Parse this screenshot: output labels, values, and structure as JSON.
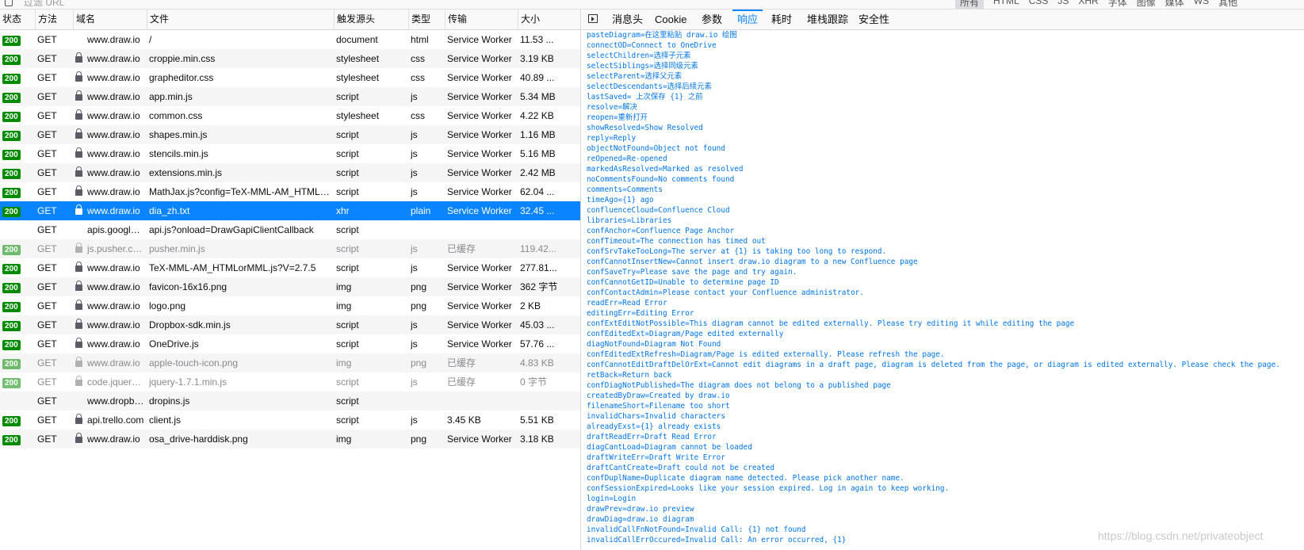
{
  "toolbar": {
    "filter_placeholder": "过滤 URL",
    "type_filters": [
      "所有",
      "HTML",
      "CSS",
      "JS",
      "XHR",
      "字体",
      "图像",
      "媒体",
      "WS",
      "其他"
    ]
  },
  "columns": [
    "状态",
    "方法",
    "域名",
    "文件",
    "触发源头",
    "类型",
    "传输",
    "大小"
  ],
  "requests": [
    {
      "status": "200",
      "method": "GET",
      "secure": false,
      "domain": "www.draw.io",
      "file": "/",
      "cause": "document",
      "type": "html",
      "transfer": "Service Worker",
      "size": "11.53 ..."
    },
    {
      "status": "200",
      "method": "GET",
      "secure": true,
      "domain": "www.draw.io",
      "file": "croppie.min.css",
      "cause": "stylesheet",
      "type": "css",
      "transfer": "Service Worker",
      "size": "3.19 KB"
    },
    {
      "status": "200",
      "method": "GET",
      "secure": true,
      "domain": "www.draw.io",
      "file": "grapheditor.css",
      "cause": "stylesheet",
      "type": "css",
      "transfer": "Service Worker",
      "size": "40.89 ..."
    },
    {
      "status": "200",
      "method": "GET",
      "secure": true,
      "domain": "www.draw.io",
      "file": "app.min.js",
      "cause": "script",
      "type": "js",
      "transfer": "Service Worker",
      "size": "5.34 MB"
    },
    {
      "status": "200",
      "method": "GET",
      "secure": true,
      "domain": "www.draw.io",
      "file": "common.css",
      "cause": "stylesheet",
      "type": "css",
      "transfer": "Service Worker",
      "size": "4.22 KB"
    },
    {
      "status": "200",
      "method": "GET",
      "secure": true,
      "domain": "www.draw.io",
      "file": "shapes.min.js",
      "cause": "script",
      "type": "js",
      "transfer": "Service Worker",
      "size": "1.16 MB"
    },
    {
      "status": "200",
      "method": "GET",
      "secure": true,
      "domain": "www.draw.io",
      "file": "stencils.min.js",
      "cause": "script",
      "type": "js",
      "transfer": "Service Worker",
      "size": "5.16 MB"
    },
    {
      "status": "200",
      "method": "GET",
      "secure": true,
      "domain": "www.draw.io",
      "file": "extensions.min.js",
      "cause": "script",
      "type": "js",
      "transfer": "Service Worker",
      "size": "2.42 MB"
    },
    {
      "status": "200",
      "method": "GET",
      "secure": true,
      "domain": "www.draw.io",
      "file": "MathJax.js?config=TeX-MML-AM_HTMLorM...",
      "cause": "script",
      "type": "js",
      "transfer": "Service Worker",
      "size": "62.04 ..."
    },
    {
      "status": "200",
      "method": "GET",
      "secure": true,
      "domain": "www.draw.io",
      "file": "dia_zh.txt",
      "cause": "xhr",
      "type": "plain",
      "transfer": "Service Worker",
      "size": "32.45 ...",
      "selected": true
    },
    {
      "status": "",
      "method": "GET",
      "secure": false,
      "domain": "apis.google....",
      "file": "api.js?onload=DrawGapiClientCallback",
      "cause": "script",
      "type": "",
      "transfer": "",
      "size": ""
    },
    {
      "status": "200",
      "method": "GET",
      "secure": true,
      "domain": "js.pusher.com",
      "file": "pusher.min.js",
      "cause": "script",
      "type": "js",
      "transfer": "已缓存",
      "size": "119.42...",
      "cached": true
    },
    {
      "status": "200",
      "method": "GET",
      "secure": true,
      "domain": "www.draw.io",
      "file": "TeX-MML-AM_HTMLorMML.js?V=2.7.5",
      "cause": "script",
      "type": "js",
      "transfer": "Service Worker",
      "size": "277.81..."
    },
    {
      "status": "200",
      "method": "GET",
      "secure": true,
      "domain": "www.draw.io",
      "file": "favicon-16x16.png",
      "cause": "img",
      "type": "png",
      "transfer": "Service Worker",
      "size": "362 字节"
    },
    {
      "status": "200",
      "method": "GET",
      "secure": true,
      "domain": "www.draw.io",
      "file": "logo.png",
      "cause": "img",
      "type": "png",
      "transfer": "Service Worker",
      "size": "2 KB"
    },
    {
      "status": "200",
      "method": "GET",
      "secure": true,
      "domain": "www.draw.io",
      "file": "Dropbox-sdk.min.js",
      "cause": "script",
      "type": "js",
      "transfer": "Service Worker",
      "size": "45.03 ..."
    },
    {
      "status": "200",
      "method": "GET",
      "secure": true,
      "domain": "www.draw.io",
      "file": "OneDrive.js",
      "cause": "script",
      "type": "js",
      "transfer": "Service Worker",
      "size": "57.76 ..."
    },
    {
      "status": "200",
      "method": "GET",
      "secure": true,
      "domain": "www.draw.io",
      "file": "apple-touch-icon.png",
      "cause": "img",
      "type": "png",
      "transfer": "已缓存",
      "size": "4.83 KB",
      "cached": true
    },
    {
      "status": "200",
      "method": "GET",
      "secure": true,
      "domain": "code.jquery....",
      "file": "jquery-1.7.1.min.js",
      "cause": "script",
      "type": "js",
      "transfer": "已缓存",
      "size": "0 字节",
      "cached": true
    },
    {
      "status": "",
      "method": "GET",
      "secure": false,
      "domain": "www.dropbo...",
      "file": "dropins.js",
      "cause": "script",
      "type": "",
      "transfer": "",
      "size": ""
    },
    {
      "status": "200",
      "method": "GET",
      "secure": true,
      "domain": "api.trello.com",
      "file": "client.js",
      "cause": "script",
      "type": "js",
      "transfer": "3.45 KB",
      "size": "5.51 KB"
    },
    {
      "status": "200",
      "method": "GET",
      "secure": true,
      "domain": "www.draw.io",
      "file": "osa_drive-harddisk.png",
      "cause": "img",
      "type": "png",
      "transfer": "Service Worker",
      "size": "3.18 KB"
    }
  ],
  "detail_tabs": [
    "消息头",
    "Cookie",
    "参数",
    "响应",
    "耗时",
    "堆栈跟踪",
    "安全性"
  ],
  "active_detail_tab": "响应",
  "response_lines": [
    "pasteDiagram=在这里粘贴 draw.io 绘图",
    "connectOD=Connect to OneDrive",
    "selectChildren=选择子元素",
    "selectSiblings=选择同级元素",
    "selectParent=选择父元素",
    "selectDescendants=选择后续元素",
    "lastSaved= 上次保存 {1} 之前",
    "resolve=解决",
    "reopen=重新打开",
    "showResolved=Show Resolved",
    "reply=Reply",
    "objectNotFound=Object not found",
    "reOpened=Re-opened",
    "markedAsResolved=Marked as resolved",
    "noCommentsFound=No comments found",
    "comments=Comments",
    "timeAgo={1} ago",
    "confluenceCloud=Confluence Cloud",
    "libraries=Libraries",
    "confAnchor=Confluence Page Anchor",
    "confTimeout=The connection has timed out",
    "confSrvTakeTooLong=The server at {1} is taking too long to respond.",
    "confCannotInsertNew=Cannot insert draw.io diagram to a new Confluence page",
    "confSaveTry=Please save the page and try again.",
    "confCannotGetID=Unable to determine page ID",
    "confContactAdmin=Please contact your Confluence administrator.",
    "readErr=Read Error",
    "editingErr=Editing Error",
    "confExtEditNotPossible=This diagram cannot be edited externally. Please try editing it while editing the page",
    "confEditedExt=Diagram/Page edited externally",
    "diagNotFound=Diagram Not Found",
    "confEditedExtRefresh=Diagram/Page is edited externally. Please refresh the page.",
    "confCannotEditDraftDelOrExt=Cannot edit diagrams in a draft page, diagram is deleted from the page, or diagram is edited externally. Please check the page.",
    "retBack=Return back",
    "confDiagNotPublished=The diagram does not belong to a published page",
    "createdByDraw=Created by draw.io",
    "filenameShort=Filename too short",
    "invalidChars=Invalid characters",
    "alreadyExst={1} already exists",
    "draftReadErr=Draft Read Error",
    "diagCantLoad=Diagram cannot be loaded",
    "draftWriteErr=Draft Write Error",
    "draftCantCreate=Draft could not be created",
    "confDuplName=Duplicate diagram name detected. Please pick another name.",
    "confSessionExpired=Looks like your session expired. Log in again to keep working.",
    "login=Login",
    "drawPrev=draw.io preview",
    "drawDiag=draw.io diagram",
    "invalidCallFnNotFound=Invalid Call: {1} not found",
    "invalidCallErrOccured=Invalid Call: An error occurred, {1}"
  ],
  "watermark": "https://blog.csdn.net/privateobject",
  "colors": {
    "accent": "#0a84ff",
    "status_ok": "#058b00",
    "response_text": "#0074e8"
  }
}
